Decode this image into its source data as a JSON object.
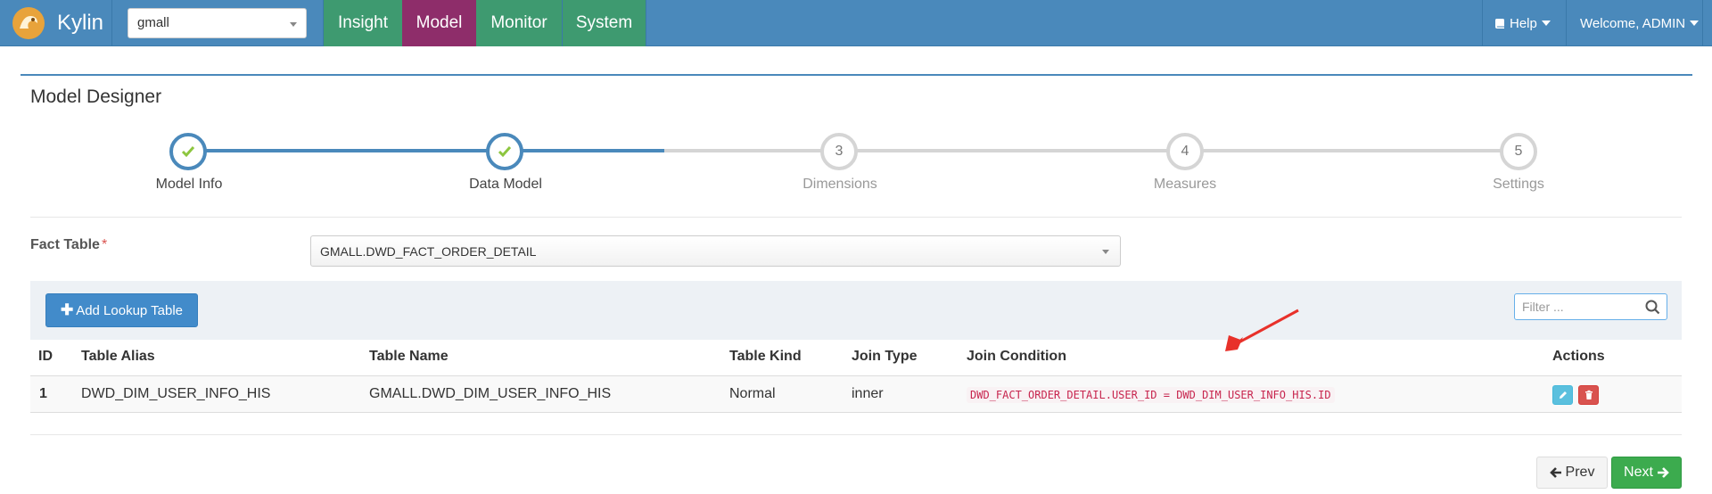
{
  "navbar": {
    "brand": "Kylin",
    "project": "gmall",
    "tabs": [
      {
        "label": "Insight",
        "active": false
      },
      {
        "label": "Model",
        "active": true
      },
      {
        "label": "Monitor",
        "active": false
      },
      {
        "label": "System",
        "active": false
      }
    ],
    "help_label": "Help",
    "welcome_label": "Welcome, ADMIN"
  },
  "page": {
    "title": "Model Designer"
  },
  "wizard": {
    "steps": [
      {
        "label": "Model Info",
        "number": "1",
        "done": true
      },
      {
        "label": "Data Model",
        "number": "2",
        "done": true
      },
      {
        "label": "Dimensions",
        "number": "3",
        "done": false
      },
      {
        "label": "Measures",
        "number": "4",
        "done": false
      },
      {
        "label": "Settings",
        "number": "5",
        "done": false
      }
    ]
  },
  "fact_table": {
    "label": "Fact Table",
    "required_mark": "*",
    "value": "GMALL.DWD_FACT_ORDER_DETAIL"
  },
  "toolbar": {
    "add_lookup_label": "Add Lookup Table",
    "filter_placeholder": "Filter ..."
  },
  "table": {
    "headers": [
      "ID",
      "Table Alias",
      "Table Name",
      "Table Kind",
      "Join Type",
      "Join Condition",
      "Actions"
    ],
    "rows": [
      {
        "id": "1",
        "alias": "DWD_DIM_USER_INFO_HIS",
        "name": "GMALL.DWD_DIM_USER_INFO_HIS",
        "kind": "Normal",
        "join_type": "inner",
        "join_condition": "DWD_FACT_ORDER_DETAIL.USER_ID = DWD_DIM_USER_INFO_HIS.ID"
      }
    ]
  },
  "footer": {
    "prev_label": "Prev",
    "next_label": "Next"
  },
  "colors": {
    "navbar": "#4a89bb",
    "tab": "#3e9a70",
    "tab_active": "#8e2d6a",
    "primary": "#428bca",
    "success": "#3cab4e",
    "danger": "#d9534f",
    "info": "#5bc0de",
    "check": "#8dc63f"
  }
}
